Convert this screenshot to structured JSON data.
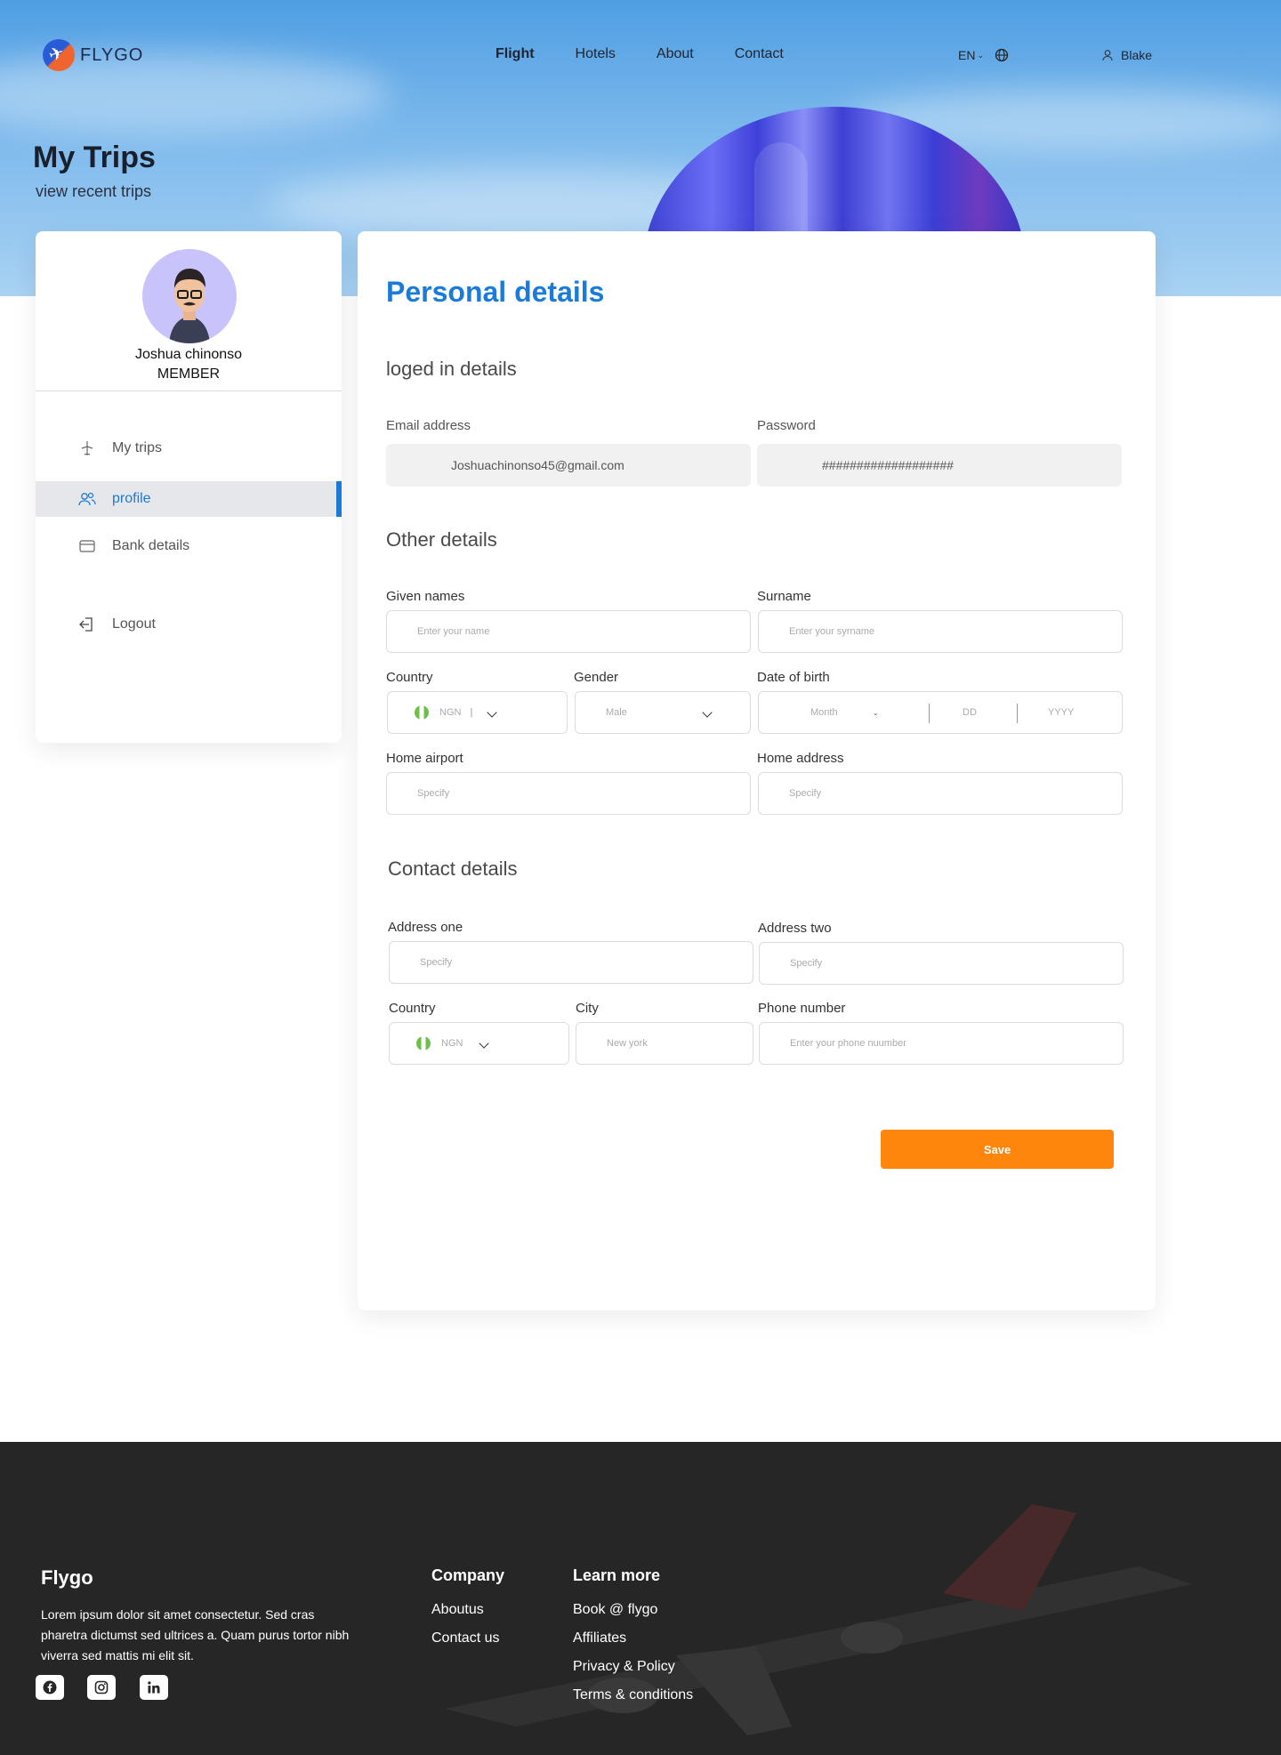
{
  "header": {
    "brand": "FLYGO",
    "nav": [
      "Flight",
      "Hotels",
      "About",
      "Contact"
    ],
    "language": "EN",
    "user": "Blake"
  },
  "page": {
    "title": "My Trips",
    "subtitle": "view recent trips"
  },
  "sidebar": {
    "name": "Joshua chinonso",
    "role": "MEMBER",
    "items": [
      {
        "label": "My trips",
        "icon": "plane-icon"
      },
      {
        "label": "profile",
        "icon": "users-icon"
      },
      {
        "label": "Bank details",
        "icon": "card-icon"
      },
      {
        "label": "Logout",
        "icon": "logout-icon"
      }
    ],
    "active_item": "profile"
  },
  "main": {
    "title": "Personal details",
    "logged_in": {
      "title": "loged in details",
      "email_label": "Email address",
      "email_value": "Joshuachinonso45@gmail.com",
      "password_label": "Password",
      "password_value": "###################"
    },
    "other": {
      "title": "Other details",
      "given_label": "Given names",
      "given_placeholder": "Enter your name",
      "surname_label": "Surname",
      "surname_placeholder": "Enter your syrname",
      "country_label": "Country",
      "country_value": "NGN",
      "gender_label": "Gender",
      "gender_value": "Male",
      "dob_label": "Date of birth",
      "dob_month": "Month",
      "dob_day": "DD",
      "dob_year": "YYYY",
      "airport_label": "Home airport",
      "airport_placeholder": "Specify",
      "address_label": "Home address",
      "address_placeholder": "Specify"
    },
    "contact": {
      "title": "Contact details",
      "addr1_label": "Address one",
      "addr1_placeholder": "Specify",
      "addr2_label": "Address two",
      "addr2_placeholder": "Specify",
      "country_label": "Country",
      "country_value": "NGN",
      "city_label": "City",
      "city_placeholder": "New york",
      "phone_label": "Phone number",
      "phone_placeholder": "Enter your phone nuumber"
    },
    "save_label": "Save"
  },
  "footer": {
    "brand": "Flygo",
    "description": "Lorem ipsum dolor sit amet consectetur. Sed cras pharetra dictumst sed ultrices a. Quam purus tortor nibh viverra sed mattis mi elit sit.",
    "social": [
      "facebook-icon",
      "instagram-icon",
      "linkedin-icon"
    ],
    "company_title": "Company",
    "company_links": [
      "Aboutus",
      "Contact us"
    ],
    "learn_title": "Learn more",
    "learn_links": [
      "Book @ flygo",
      "Affiliates",
      "Privacy & Policy",
      "Terms & conditions"
    ]
  },
  "colors": {
    "accent": "#1a7bd8",
    "save": "#ff860d",
    "footer_bg": "#262626"
  }
}
